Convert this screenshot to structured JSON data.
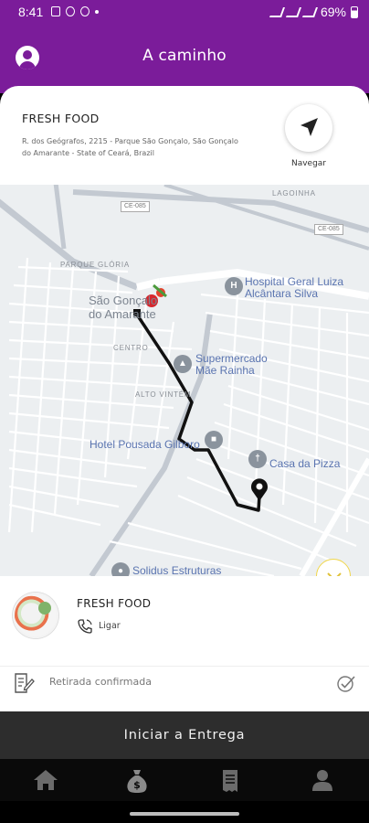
{
  "status_bar": {
    "time": "8:41",
    "battery": "69%"
  },
  "header": {
    "title": "A caminho",
    "profile_icon": "account-circle-icon",
    "color": "#7b1c9a"
  },
  "pickup": {
    "store_name": "FRESH FOOD",
    "address": "R. dos Geógrafos, 2215 - Parque São Gonçalo, São Gonçalo do Amarante - State of Ceará, Brazil",
    "navigate_label": "Navegar",
    "navigate_icon": "navigation-arrow-icon"
  },
  "map": {
    "road_codes": [
      "CE-085",
      "CE-085"
    ],
    "neighborhoods": [
      "LAGOINHA",
      "PARQUE GLÓRIA",
      "CENTRO",
      "ALTO VINTÉM"
    ],
    "town": "São Gonçalo do Amarante",
    "pois": [
      {
        "name": "Hospital Geral Luiza Alcântara Silva",
        "icon": "hospital-icon"
      },
      {
        "name": "Supermercado Mãe Rainha",
        "icon": "shopping-cart-icon"
      },
      {
        "name": "Hotel Pousada Gilboro",
        "icon": "hotel-icon"
      },
      {
        "name": "Casa da Pizza",
        "icon": "restaurant-icon"
      },
      {
        "name": "Solidus Estruturas",
        "icon": "place-icon"
      }
    ],
    "route_color": "#111111"
  },
  "store_panel": {
    "store_name": "FRESH FOOD",
    "call_label": "Ligar",
    "status": "Retirada confirmada"
  },
  "actions": {
    "start_delivery": "Iniciar a Entrega"
  },
  "tabs": [
    {
      "name": "home",
      "icon": "home-icon"
    },
    {
      "name": "earnings",
      "icon": "money-bag-icon"
    },
    {
      "name": "orders",
      "icon": "receipt-icon"
    },
    {
      "name": "profile",
      "icon": "person-icon"
    }
  ]
}
